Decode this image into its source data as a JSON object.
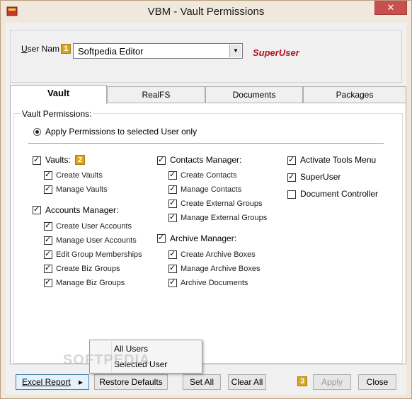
{
  "window": {
    "title": "VBM - Vault Permissions",
    "close_glyph": "✕"
  },
  "user": {
    "label_prefix": "U",
    "label_rest": "ser Nam",
    "badge": "1",
    "selected": "Softpedia Editor",
    "role": "SuperUser"
  },
  "tabs": [
    {
      "label": "Vault",
      "active": true
    },
    {
      "label": "RealFS",
      "active": false
    },
    {
      "label": "Documents",
      "active": false
    },
    {
      "label": "Packages",
      "active": false
    }
  ],
  "permissions": {
    "group_title": "Vault Permissions:",
    "apply_option": "Apply Permissions to selected User only",
    "vaults": {
      "label": "Vaults:",
      "badge": "2",
      "checked": true,
      "items": [
        {
          "label": "Create Vaults",
          "checked": true
        },
        {
          "label": "Manage Vaults",
          "checked": true
        }
      ]
    },
    "accounts": {
      "label": "Accounts Manager:",
      "checked": true,
      "items": [
        {
          "label": "Create User Accounts",
          "checked": true
        },
        {
          "label": "Manage User Accounts",
          "checked": true
        },
        {
          "label": "Edit Group Memberships",
          "checked": true
        },
        {
          "label": "Create Biz Groups",
          "checked": true
        },
        {
          "label": "Manage Biz Groups",
          "checked": true
        }
      ]
    },
    "contacts": {
      "label": "Contacts Manager:",
      "checked": true,
      "items": [
        {
          "label": "Create Contacts",
          "checked": true
        },
        {
          "label": "Manage Contacts",
          "checked": true
        },
        {
          "label": "Create External Groups",
          "checked": true
        },
        {
          "label": "Manage External Groups",
          "checked": true
        }
      ]
    },
    "archive": {
      "label": "Archive Manager:",
      "checked": true,
      "items": [
        {
          "label": "Create Archive Boxes",
          "checked": true
        },
        {
          "label": "Manage Archive Boxes",
          "checked": true
        },
        {
          "label": "Archive Documents",
          "checked": true
        }
      ]
    },
    "extras": [
      {
        "label": "Activate Tools Menu",
        "checked": true
      },
      {
        "label": "SuperUser",
        "checked": true
      },
      {
        "label": "Document Controller",
        "checked": false
      }
    ]
  },
  "popup_menu": {
    "items": [
      "All Users",
      "Selected User"
    ]
  },
  "buttons": {
    "excel_report": "Excel Report",
    "excel_arrow": "▸",
    "restore_defaults": "Restore Defaults",
    "set_all": "Set All",
    "clear_all": "Clear All",
    "badge3": "3",
    "apply": "Apply",
    "close": "Close"
  },
  "watermark": "SOFTPEDIA"
}
